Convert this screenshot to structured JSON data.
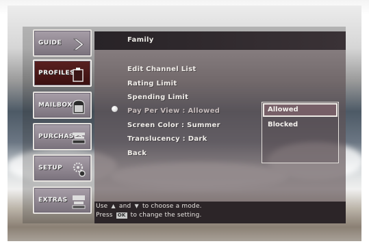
{
  "sidebar": {
    "items": [
      {
        "label": "GUIDE",
        "icon": "chevron-right-icon"
      },
      {
        "label": "PROFILES",
        "icon": "profile-card-icon",
        "active": true
      },
      {
        "label": "MAILBOX",
        "icon": "mailbox-icon"
      },
      {
        "label": "PURCHASES",
        "icon": "purchases-icon"
      },
      {
        "label": "SETUP",
        "icon": "setup-gear-icon"
      },
      {
        "label": "EXTRAS",
        "icon": "extras-icon"
      }
    ]
  },
  "header": {
    "title": "Family"
  },
  "menu": {
    "items": [
      {
        "label": "Edit Channel List"
      },
      {
        "label": "Rating Limit"
      },
      {
        "label": "Spending Limit"
      },
      {
        "label": "Pay Per View : Allowed",
        "selected": true
      },
      {
        "label": "Screen Color : Summer"
      },
      {
        "label": "Translucency : Dark"
      },
      {
        "label": "Back"
      }
    ]
  },
  "options": {
    "items": [
      {
        "label": "Allowed",
        "highlighted": true
      },
      {
        "label": "Blocked"
      }
    ]
  },
  "footer": {
    "line1_prefix": "Use",
    "line1_and": "and",
    "line1_suffix": "to choose a mode.",
    "line2_prefix": "Press",
    "line2_key": "OK",
    "line2_suffix": "to change the setting."
  },
  "colors": {
    "header_bg": "#2f282c",
    "active_button": "#4a1818",
    "panel_text": "#f1eeea",
    "highlight_border": "#f0ece7"
  }
}
